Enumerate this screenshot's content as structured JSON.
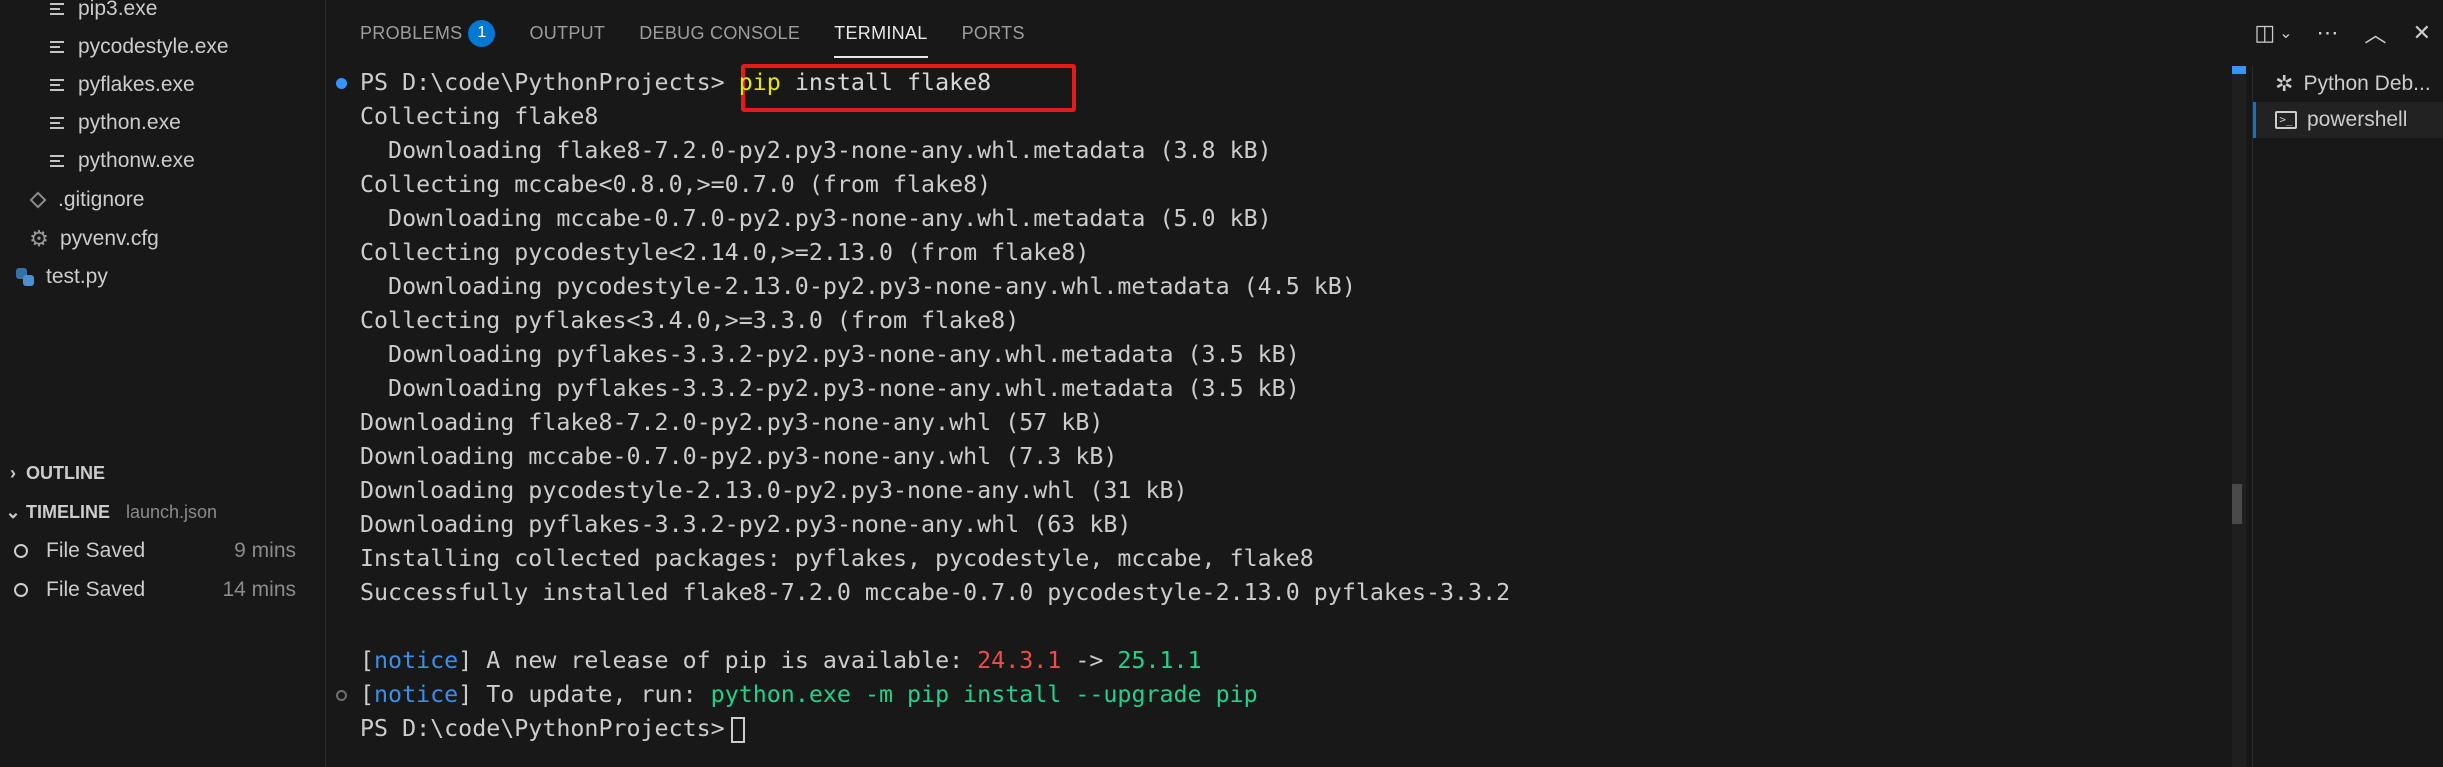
{
  "sidebar": {
    "files": [
      {
        "name": "pip3.exe",
        "icon": "file-lines-icon"
      },
      {
        "name": "pycodestyle.exe",
        "icon": "file-lines-icon"
      },
      {
        "name": "pyflakes.exe",
        "icon": "file-lines-icon"
      },
      {
        "name": "python.exe",
        "icon": "file-lines-icon"
      },
      {
        "name": "pythonw.exe",
        "icon": "file-lines-icon"
      },
      {
        "name": ".gitignore",
        "icon": "gitignore-icon"
      },
      {
        "name": "pyvenv.cfg",
        "icon": "gear-icon"
      },
      {
        "name": "test.py",
        "icon": "python-icon"
      }
    ],
    "outline_label": "OUTLINE",
    "timeline_label": "TIMELINE",
    "timeline_file": "launch.json",
    "timeline": [
      {
        "label": "File Saved",
        "time": "9 mins"
      },
      {
        "label": "File Saved",
        "time": "14 mins"
      }
    ]
  },
  "panel": {
    "tabs": [
      {
        "label": "PROBLEMS",
        "badge": "1"
      },
      {
        "label": "OUTPUT"
      },
      {
        "label": "DEBUG CONSOLE"
      },
      {
        "label": "TERMINAL",
        "active": true
      },
      {
        "label": "PORTS"
      }
    ],
    "header_icons": [
      "split-terminal-icon",
      "chevron-down-icon",
      "more-icon",
      "maximize-icon",
      "close-icon"
    ]
  },
  "terminal": {
    "prompt": "PS D:\\code\\PythonProjects>",
    "command_pip": "pip",
    "command_rest": " install flake8",
    "lines": [
      "Collecting flake8",
      "  Downloading flake8-7.2.0-py2.py3-none-any.whl.metadata (3.8 kB)",
      "Collecting mccabe<0.8.0,>=0.7.0 (from flake8)",
      "  Downloading mccabe-0.7.0-py2.py3-none-any.whl.metadata (5.0 kB)",
      "Collecting pycodestyle<2.14.0,>=2.13.0 (from flake8)",
      "  Downloading pycodestyle-2.13.0-py2.py3-none-any.whl.metadata (4.5 kB)",
      "Collecting pyflakes<3.4.0,>=3.3.0 (from flake8)",
      "  Downloading pyflakes-3.3.2-py2.py3-none-any.whl.metadata (3.5 kB)",
      "  Downloading pyflakes-3.3.2-py2.py3-none-any.whl.metadata (3.5 kB)",
      "Downloading flake8-7.2.0-py2.py3-none-any.whl (57 kB)",
      "Downloading mccabe-0.7.0-py2.py3-none-any.whl (7.3 kB)",
      "Downloading pycodestyle-2.13.0-py2.py3-none-any.whl (31 kB)",
      "Downloading pyflakes-3.3.2-py2.py3-none-any.whl (63 kB)",
      "Installing collected packages: pyflakes, pycodestyle, mccabe, flake8",
      "Successfully installed flake8-7.2.0 mccabe-0.7.0 pycodestyle-2.13.0 pyflakes-3.3.2"
    ],
    "notice1": {
      "tag": "notice",
      "text": " A new release of pip is available: ",
      "old_version": "24.3.1",
      "arrow": " -> ",
      "new_version": "25.1.1"
    },
    "notice2": {
      "tag": "notice",
      "text": " To update, run: ",
      "command": "python.exe -m pip install --upgrade pip"
    },
    "final_prompt": "PS D:\\code\\PythonProjects>"
  },
  "terminal_list": [
    {
      "label": "Python Deb...",
      "icon": "bug-icon"
    },
    {
      "label": "powershell",
      "icon": "powershell-icon",
      "active": true
    }
  ],
  "colors": {
    "background": "#181818",
    "accent": "#0078d4",
    "highlight_box": "#e51b1b",
    "notice": "#3b8eea",
    "old_version": "#f14c4c",
    "new_version": "#23d18b",
    "pip_keyword": "#e5e510"
  }
}
